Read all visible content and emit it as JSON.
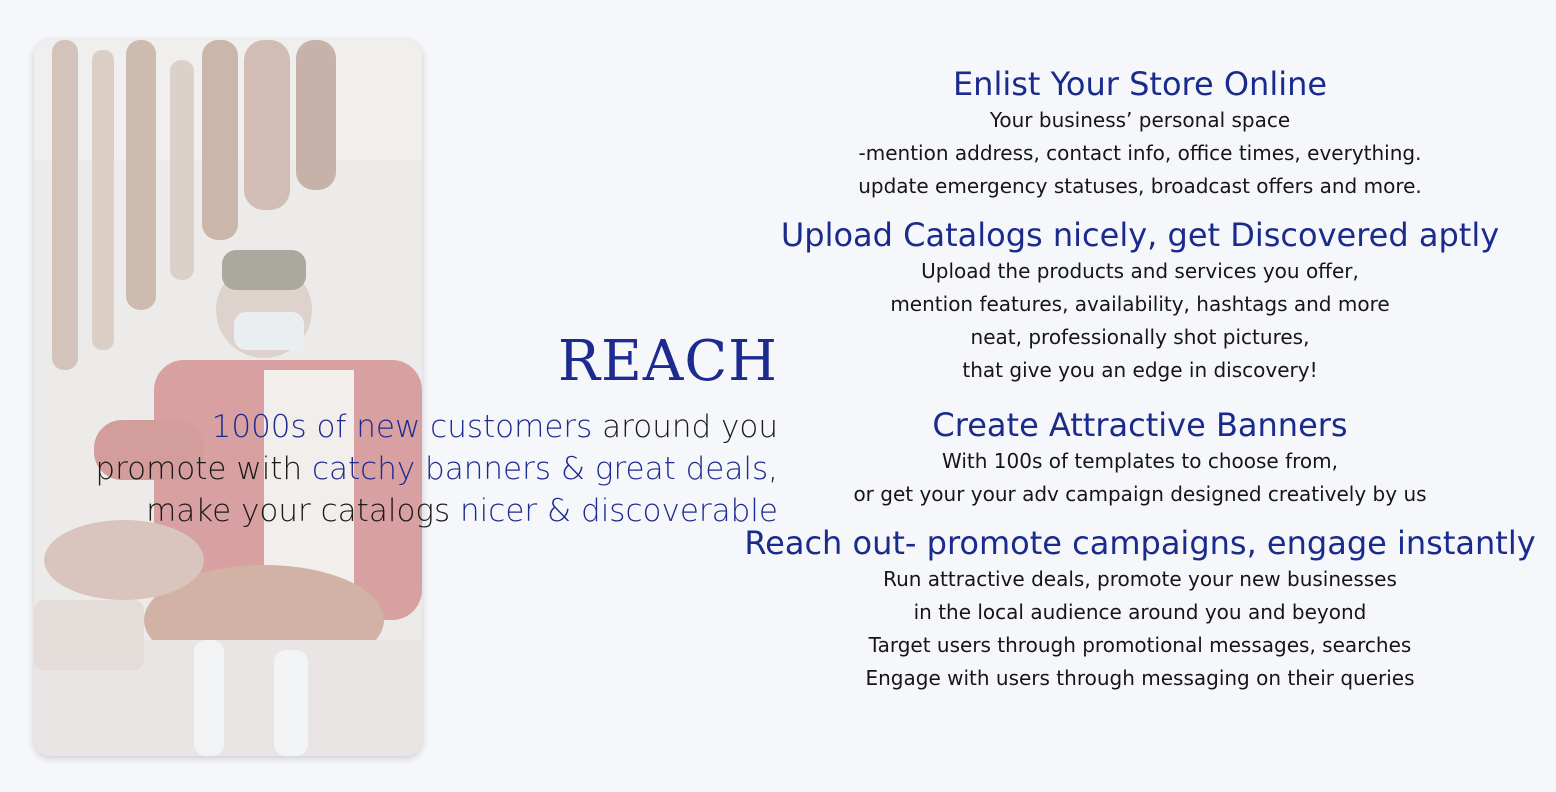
{
  "reach": {
    "title": "REACH",
    "line1": {
      "hl": "1000s of new customers",
      "rest": " around you"
    },
    "line2": {
      "pre": "promote with ",
      "hl": "catchy banners & great deals",
      "post": ","
    },
    "line3": {
      "pre": "make your catalogs ",
      "hl": "nicer & discoverable"
    }
  },
  "features": [
    {
      "title": "Enlist Your Store Online",
      "lines": [
        "Your business’ personal space",
        "-mention address, contact info, office times, everything.",
        "update emergency statuses, broadcast offers and more."
      ]
    },
    {
      "title": "Upload Catalogs nicely, get Discovered aptly",
      "lines": [
        "Upload the products and services you offer,",
        "mention features, availability, hashtags and more",
        "neat, professionally shot pictures,",
        "that give you an edge in discovery!"
      ]
    },
    {
      "title": "Create Attractive Banners",
      "lines": [
        "With 100s of templates to choose from,",
        "or get your your adv campaign designed creatively by us"
      ]
    },
    {
      "title": "Reach out- promote campaigns, engage instantly",
      "lines": [
        "Run attractive deals, promote your new businesses",
        "in the local audience around you and beyond",
        "Target users through promotional messages, searches",
        "Engage with users through messaging on their queries"
      ]
    }
  ],
  "colors": {
    "accent": "#1d2a8f",
    "text": "#161616",
    "background": "#f5f7fa"
  }
}
